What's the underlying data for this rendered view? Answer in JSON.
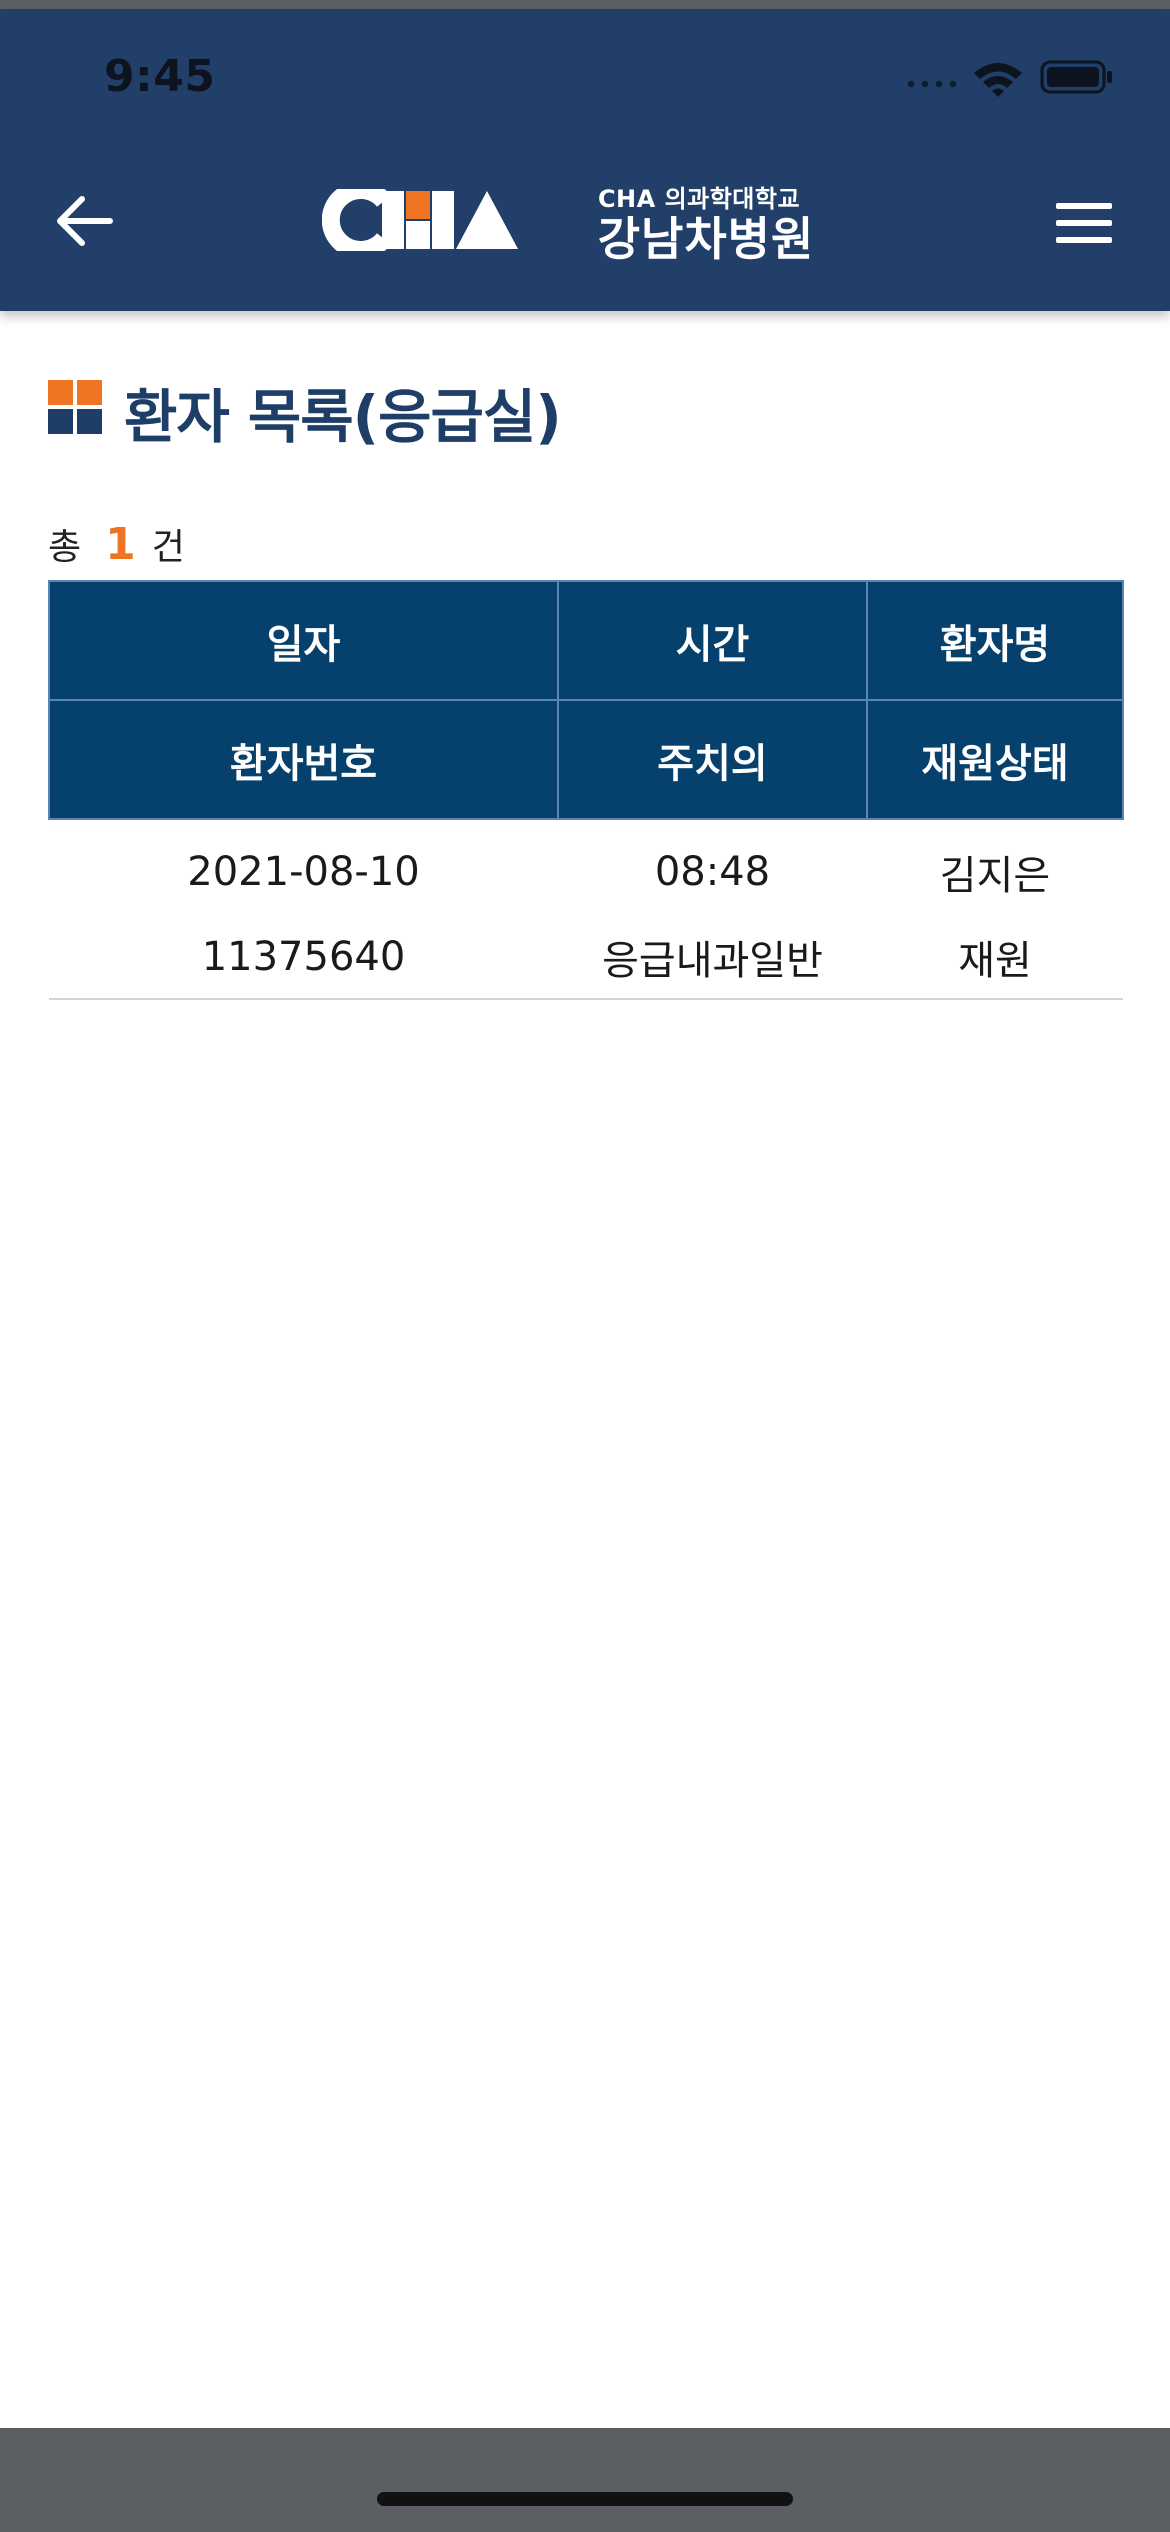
{
  "status_bar": {
    "time": "9:45"
  },
  "header": {
    "logo_subtitle": "CHA 의과학대학교",
    "logo_title": "강남차병원",
    "back_icon": "arrow-left-icon",
    "menu_icon": "hamburger-menu-icon"
  },
  "page": {
    "title": "환자 목록(응급실)",
    "count_prefix": "총",
    "count": "1",
    "count_suffix": "건"
  },
  "table": {
    "headers_row1": [
      "일자",
      "시간",
      "환자명"
    ],
    "headers_row2": [
      "환자번호",
      "주치의",
      "재원상태"
    ],
    "rows": [
      {
        "date": "2021-08-10",
        "time": "08:48",
        "patient_name": "김지은",
        "patient_number": "11375640",
        "attending_physician": "응급내과일반",
        "admission_status": "재원"
      }
    ]
  },
  "colors": {
    "header_bg": "#213f68",
    "table_header_bg": "#06406d",
    "accent_orange": "#ee7424",
    "title_blue": "#1e3e68"
  }
}
